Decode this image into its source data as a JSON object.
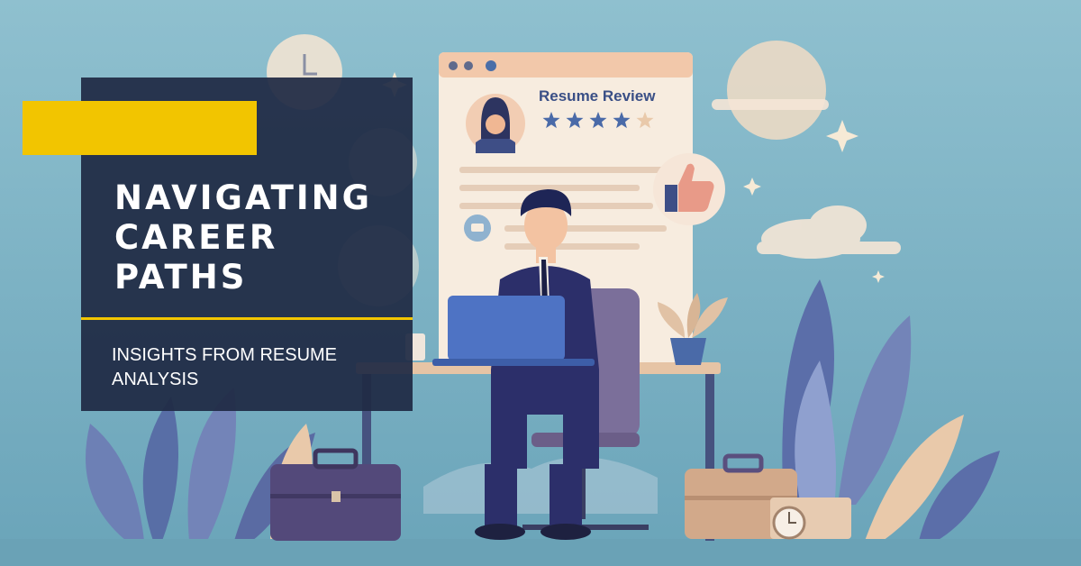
{
  "headline": {
    "lines": [
      "NAVIGATING",
      "CAREER",
      "PATHS"
    ]
  },
  "subtitle": {
    "lines": [
      "INSIGHTS FROM RESUME",
      "ANALYSIS"
    ]
  },
  "resume_card": {
    "title": "Resume Review",
    "rating_stars": 4
  },
  "colors": {
    "accent": "#f2c500",
    "overlay": "#1f2a44",
    "background": "#7fb3c4"
  }
}
